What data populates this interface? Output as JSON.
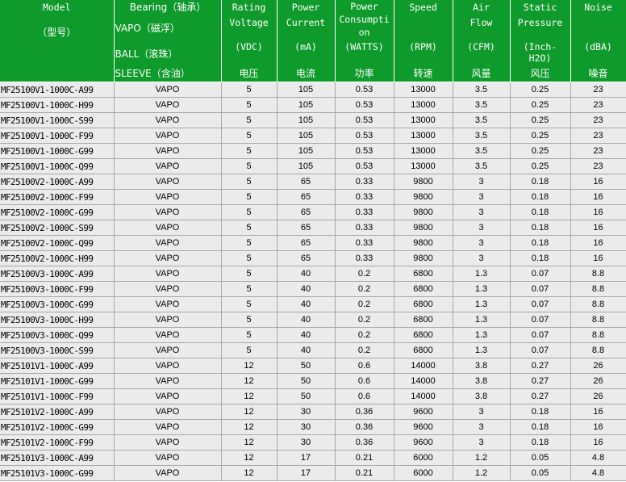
{
  "header": {
    "model": {
      "title": "Model",
      "cn": "（型号）"
    },
    "bearing": {
      "title": "Bearing（轴承）",
      "vapo": "VAPO（磁浮）",
      "ball": "BALL（滚珠）",
      "sleeve": "SLEEVE（含油）"
    },
    "voltage": {
      "title1": "Rating",
      "title2": "Voltage",
      "unit": "(VDC)",
      "cn": "电压"
    },
    "current": {
      "title1": "Power",
      "title2": "Current",
      "unit": "(mA)",
      "cn": "电流"
    },
    "power": {
      "title1": "Power",
      "title2": "Consumpti",
      "title3": "on",
      "unit": "(WATTS)",
      "cn": "功率"
    },
    "speed": {
      "title": "Speed",
      "unit": "(RPM)",
      "cn": "转速"
    },
    "airflow": {
      "title1": "Air",
      "title2": "Flow",
      "unit": "(CFM)",
      "cn": "风量"
    },
    "pressure": {
      "title1": "Static",
      "title2": "Pressure",
      "unit1": "(Inch-",
      "unit2": "H2O)",
      "cn": "风压"
    },
    "noise": {
      "title": "Noise",
      "unit": "(dBA)",
      "cn": "噪音"
    }
  },
  "rows": [
    {
      "model": "MF25100V1-1000C-A99",
      "bearing": "VAPO",
      "voltage": "5",
      "current": "105",
      "power": "0.53",
      "speed": "13000",
      "airflow": "3.5",
      "pressure": "0.25",
      "noise": "23"
    },
    {
      "model": "MF25100V1-1000C-H99",
      "bearing": "VAPO",
      "voltage": "5",
      "current": "105",
      "power": "0.53",
      "speed": "13000",
      "airflow": "3.5",
      "pressure": "0.25",
      "noise": "23"
    },
    {
      "model": "MF25100V1-1000C-S99",
      "bearing": "VAPO",
      "voltage": "5",
      "current": "105",
      "power": "0.53",
      "speed": "13000",
      "airflow": "3.5",
      "pressure": "0.25",
      "noise": "23"
    },
    {
      "model": "MF25100V1-1000C-F99",
      "bearing": "VAPO",
      "voltage": "5",
      "current": "105",
      "power": "0.53",
      "speed": "13000",
      "airflow": "3.5",
      "pressure": "0.25",
      "noise": "23"
    },
    {
      "model": "MF25100V1-1000C-G99",
      "bearing": "VAPO",
      "voltage": "5",
      "current": "105",
      "power": "0.53",
      "speed": "13000",
      "airflow": "3.5",
      "pressure": "0.25",
      "noise": "23"
    },
    {
      "model": "MF25100V1-1000C-Q99",
      "bearing": "VAPO",
      "voltage": "5",
      "current": "105",
      "power": "0.53",
      "speed": "13000",
      "airflow": "3.5",
      "pressure": "0.25",
      "noise": "23"
    },
    {
      "model": "MF25100V2-1000C-A99",
      "bearing": "VAPO",
      "voltage": "5",
      "current": "65",
      "power": "0.33",
      "speed": "9800",
      "airflow": "3",
      "pressure": "0.18",
      "noise": "16"
    },
    {
      "model": "MF25100V2-1000C-F99",
      "bearing": "VAPO",
      "voltage": "5",
      "current": "65",
      "power": "0.33",
      "speed": "9800",
      "airflow": "3",
      "pressure": "0.18",
      "noise": "16"
    },
    {
      "model": "MF25100V2-1000C-G99",
      "bearing": "VAPO",
      "voltage": "5",
      "current": "65",
      "power": "0.33",
      "speed": "9800",
      "airflow": "3",
      "pressure": "0.18",
      "noise": "16"
    },
    {
      "model": "MF25100V2-1000C-S99",
      "bearing": "VAPO",
      "voltage": "5",
      "current": "65",
      "power": "0.33",
      "speed": "9800",
      "airflow": "3",
      "pressure": "0.18",
      "noise": "16"
    },
    {
      "model": "MF25100V2-1000C-Q99",
      "bearing": "VAPO",
      "voltage": "5",
      "current": "65",
      "power": "0.33",
      "speed": "9800",
      "airflow": "3",
      "pressure": "0.18",
      "noise": "16"
    },
    {
      "model": "MF25100V2-1000C-H99",
      "bearing": "VAPO",
      "voltage": "5",
      "current": "65",
      "power": "0.33",
      "speed": "9800",
      "airflow": "3",
      "pressure": "0.18",
      "noise": "16"
    },
    {
      "model": "MF25100V3-1000C-A99",
      "bearing": "VAPO",
      "voltage": "5",
      "current": "40",
      "power": "0.2",
      "speed": "6800",
      "airflow": "1.3",
      "pressure": "0.07",
      "noise": "8.8"
    },
    {
      "model": "MF25100V3-1000C-F99",
      "bearing": "VAPO",
      "voltage": "5",
      "current": "40",
      "power": "0.2",
      "speed": "6800",
      "airflow": "1.3",
      "pressure": "0.07",
      "noise": "8.8"
    },
    {
      "model": "MF25100V3-1000C-G99",
      "bearing": "VAPO",
      "voltage": "5",
      "current": "40",
      "power": "0.2",
      "speed": "6800",
      "airflow": "1.3",
      "pressure": "0.07",
      "noise": "8.8"
    },
    {
      "model": "MF25100V3-1000C-H99",
      "bearing": "VAPO",
      "voltage": "5",
      "current": "40",
      "power": "0.2",
      "speed": "6800",
      "airflow": "1.3",
      "pressure": "0.07",
      "noise": "8.8"
    },
    {
      "model": "MF25100V3-1000C-Q99",
      "bearing": "VAPO",
      "voltage": "5",
      "current": "40",
      "power": "0.2",
      "speed": "6800",
      "airflow": "1.3",
      "pressure": "0.07",
      "noise": "8.8"
    },
    {
      "model": "MF25100V3-1000C-S99",
      "bearing": "VAPO",
      "voltage": "5",
      "current": "40",
      "power": "0.2",
      "speed": "6800",
      "airflow": "1.3",
      "pressure": "0.07",
      "noise": "8.8"
    },
    {
      "model": "MF25101V1-1000C-A99",
      "bearing": "VAPO",
      "voltage": "12",
      "current": "50",
      "power": "0.6",
      "speed": "14000",
      "airflow": "3.8",
      "pressure": "0.27",
      "noise": "26"
    },
    {
      "model": "MF25101V1-1000C-G99",
      "bearing": "VAPO",
      "voltage": "12",
      "current": "50",
      "power": "0.6",
      "speed": "14000",
      "airflow": "3.8",
      "pressure": "0.27",
      "noise": "26"
    },
    {
      "model": "MF25101V1-1000C-F99",
      "bearing": "VAPO",
      "voltage": "12",
      "current": "50",
      "power": "0.6",
      "speed": "14000",
      "airflow": "3.8",
      "pressure": "0.27",
      "noise": "26"
    },
    {
      "model": "MF25101V2-1000C-A99",
      "bearing": "VAPO",
      "voltage": "12",
      "current": "30",
      "power": "0.36",
      "speed": "9600",
      "airflow": "3",
      "pressure": "0.18",
      "noise": "16"
    },
    {
      "model": "MF25101V2-1000C-G99",
      "bearing": "VAPO",
      "voltage": "12",
      "current": "30",
      "power": "0.36",
      "speed": "9600",
      "airflow": "3",
      "pressure": "0.18",
      "noise": "16"
    },
    {
      "model": "MF25101V2-1000C-F99",
      "bearing": "VAPO",
      "voltage": "12",
      "current": "30",
      "power": "0.36",
      "speed": "9600",
      "airflow": "3",
      "pressure": "0.18",
      "noise": "16"
    },
    {
      "model": "MF25101V3-1000C-A99",
      "bearing": "VAPO",
      "voltage": "12",
      "current": "17",
      "power": "0.21",
      "speed": "6000",
      "airflow": "1.2",
      "pressure": "0.05",
      "noise": "4.8"
    },
    {
      "model": "MF25101V3-1000C-G99",
      "bearing": "VAPO",
      "voltage": "12",
      "current": "17",
      "power": "0.21",
      "speed": "6000",
      "airflow": "1.2",
      "pressure": "0.05",
      "noise": "4.8"
    }
  ],
  "colors": {
    "header_bg": "#0f9a2c",
    "header_text": "#ffffff",
    "row_bg": "#ebebeb",
    "grid": "#a8a8a8"
  }
}
